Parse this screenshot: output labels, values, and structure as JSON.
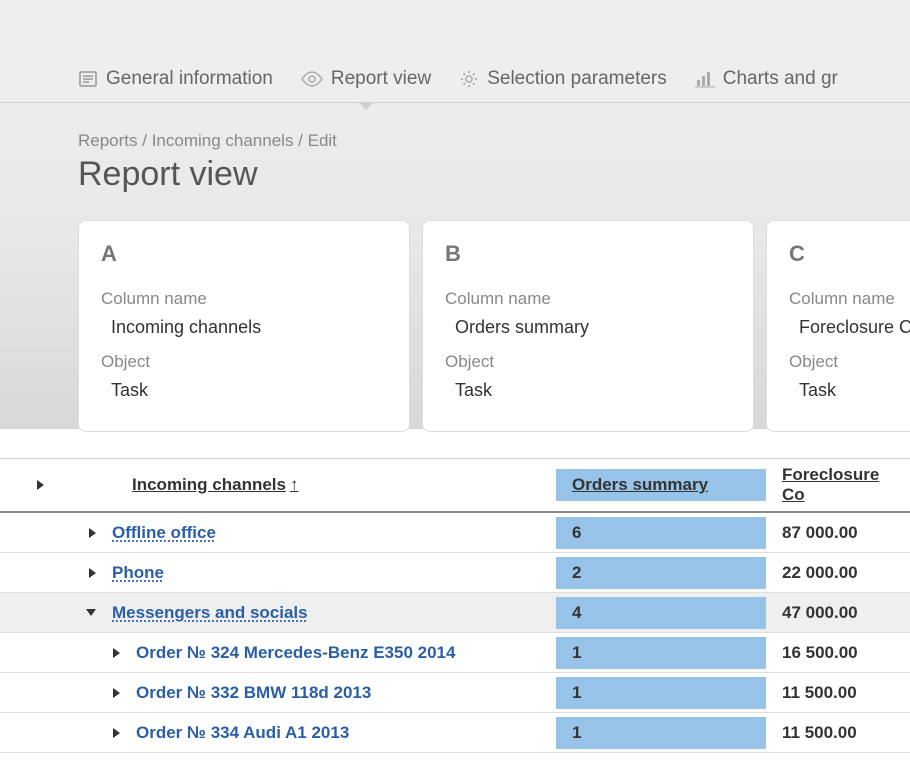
{
  "tabs": [
    {
      "label": "General information"
    },
    {
      "label": "Report view"
    },
    {
      "label": "Selection parameters"
    },
    {
      "label": "Charts and gr"
    }
  ],
  "breadcrumb": "Reports / Incoming channels / Edit",
  "title": "Report view",
  "cards": [
    {
      "letter": "A",
      "col_label": "Column name",
      "col_value": "Incoming channels",
      "obj_label": "Object",
      "obj_value": "Task"
    },
    {
      "letter": "B",
      "col_label": "Column name",
      "col_value": "Orders summary",
      "obj_label": "Object",
      "obj_value": "Task"
    },
    {
      "letter": "C",
      "col_label": "Column name",
      "col_value": "Foreclosure Co",
      "obj_label": "Object",
      "obj_value": "Task"
    }
  ],
  "table": {
    "headers": {
      "name": "Incoming channels",
      "sort": "↑",
      "orders": "Orders summary",
      "foreclosure": "Foreclosure Co"
    },
    "rows": [
      {
        "level": 1,
        "expanded": false,
        "name": "Offline office",
        "orders": "6",
        "foreclosure": "87 000.00"
      },
      {
        "level": 1,
        "expanded": false,
        "name": "Phone",
        "orders": "2",
        "foreclosure": "22 000.00"
      },
      {
        "level": 1,
        "expanded": true,
        "name": "Messengers and socials",
        "orders": "4",
        "foreclosure": "47 000.00"
      },
      {
        "level": 2,
        "expanded": false,
        "name": "Order № 324 Mercedes-Benz E350 2014",
        "orders": "1",
        "foreclosure": "16 500.00"
      },
      {
        "level": 2,
        "expanded": false,
        "name": "Order № 332 BMW 118d 2013",
        "orders": "1",
        "foreclosure": "11 500.00"
      },
      {
        "level": 2,
        "expanded": false,
        "name": "Order № 334 Audi A1 2013",
        "orders": "1",
        "foreclosure": "11 500.00"
      }
    ]
  }
}
